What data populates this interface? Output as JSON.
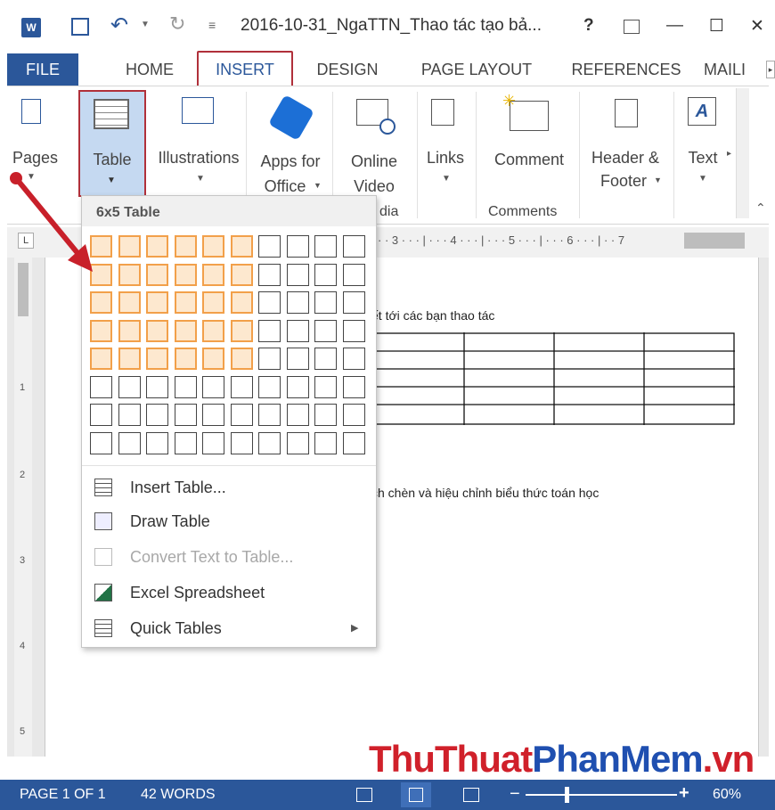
{
  "window": {
    "title": "2016-10-31_NgaTTN_Thao tác tạo bả...",
    "help": "?",
    "minimize": "—",
    "maximize": "☐",
    "close": "✕"
  },
  "tabs": [
    "FILE",
    "HOME",
    "INSERT",
    "DESIGN",
    "PAGE LAYOUT",
    "REFERENCES",
    "MAILI"
  ],
  "ribbon": {
    "pages": "Pages",
    "table": "Table",
    "illustrations": "Illustrations",
    "apps_line1": "Apps for",
    "apps_line2": "Office",
    "video_line1": "Online",
    "video_line2": "Video",
    "media_group": "dia",
    "links": "Links",
    "comment": "Comment",
    "comments_group": "Comments",
    "header_line1": "Header &",
    "header_line2": "Footer",
    "text": "Text"
  },
  "ruler": {
    "marks": "· · 3 · · · | · · · 4 · · · | · · · 5 · · · | · · · 6 · · · | · · 7"
  },
  "document": {
    "line1": "ết tới các bạn thao tác",
    "line2": "ch chèn và hiệu chỉnh biểu thức toán học"
  },
  "dropdown": {
    "header": "6x5 Table",
    "grid": {
      "cols": 10,
      "rows": 8,
      "selected_cols": 6,
      "selected_rows": 5
    },
    "items": [
      {
        "label": "Insert Table...",
        "icon": "insert-table-icon",
        "enabled": true
      },
      {
        "label": "Draw Table",
        "icon": "draw-table-icon",
        "enabled": true
      },
      {
        "label": "Convert Text to Table...",
        "icon": "convert-text-icon",
        "enabled": false
      },
      {
        "label": "Excel Spreadsheet",
        "icon": "excel-icon",
        "enabled": true
      },
      {
        "label": "Quick Tables",
        "icon": "quick-tables-icon",
        "enabled": true
      }
    ]
  },
  "status": {
    "page": "PAGE 1 OF 1",
    "words": "42 WORDS",
    "zoom": "60%"
  },
  "watermark": {
    "part1": "ThuThuat",
    "part2": "PhanMem",
    "part3": ".vn"
  },
  "colors": {
    "accent": "#2b579a",
    "highlight": "#b0303a",
    "grid_selected": "#f2a04a"
  }
}
